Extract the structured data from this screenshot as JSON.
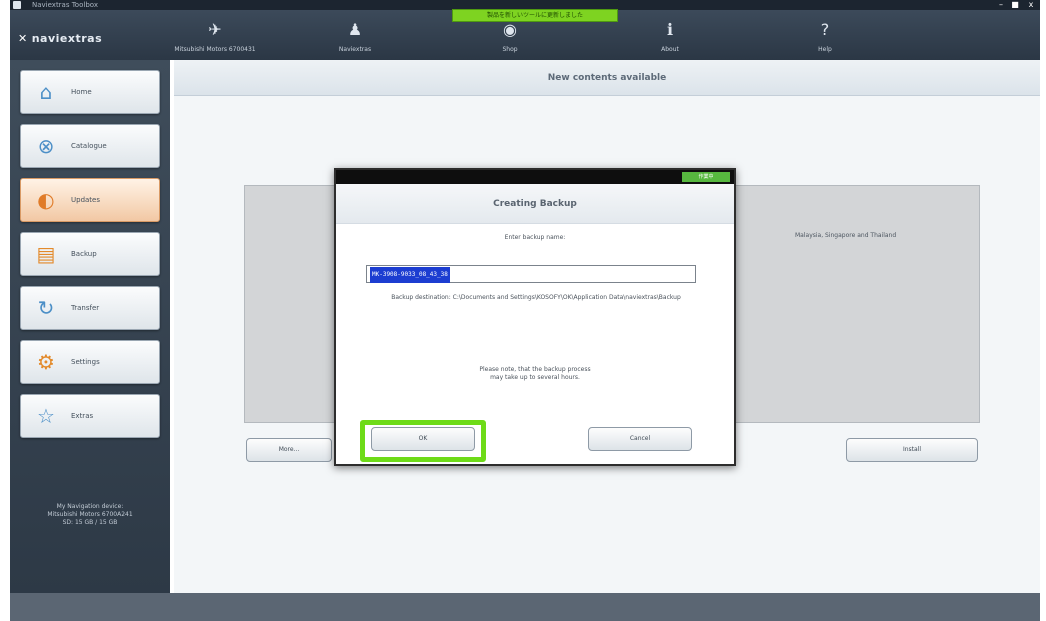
{
  "window": {
    "title": "Naviextras Toolbox",
    "controls": [
      "–",
      "■",
      "x"
    ]
  },
  "notice": "製品を新しいツールに更新しました",
  "topnav": {
    "logo": "naviextras",
    "tabs": [
      {
        "icon": "satellite-icon",
        "glyph": "✈",
        "label": "Mitsubishi Motors 6700431"
      },
      {
        "icon": "market-icon",
        "glyph": "♟",
        "label": "Naviextras"
      },
      {
        "icon": "globe-icon",
        "glyph": "◉",
        "label": "Shop"
      },
      {
        "icon": "info-icon",
        "glyph": "ℹ",
        "label": "About"
      },
      {
        "icon": "help-icon",
        "glyph": "?",
        "label": "Help"
      }
    ]
  },
  "sidebar": {
    "items": [
      {
        "label": "Home",
        "icon": "home-icon",
        "glyph": "⌂"
      },
      {
        "label": "Catalogue",
        "icon": "catalogue-icon",
        "glyph": "⊗"
      },
      {
        "label": "Updates",
        "icon": "updates-icon",
        "glyph": "◐"
      },
      {
        "label": "Backup",
        "icon": "backup-icon",
        "glyph": "▤"
      },
      {
        "label": "Transfer",
        "icon": "transfer-icon",
        "glyph": "↻"
      },
      {
        "label": "Settings",
        "icon": "settings-icon",
        "glyph": "⚙"
      },
      {
        "label": "Extras",
        "icon": "extras-icon",
        "glyph": "☆"
      }
    ],
    "active_index": 2,
    "device_info": [
      "My Navigation device:",
      "Mitsubishi Motors 6700A241",
      "SD: 15 GB / 15 GB"
    ]
  },
  "main": {
    "header": "New contents available",
    "panel_text": "Malaysia, Singapore and Thailand",
    "left_button": "More...",
    "right_button": "Install"
  },
  "dialog": {
    "tag": "作業中",
    "title": "Creating Backup",
    "prompt": "Enter backup name:",
    "input_value": "MK-3908-9033_08_43_38",
    "destination": "Backup destination: C:\\Documents and Settings\\KOSOFY\\OK\\Application Data\\naviextras\\Backup",
    "note_line1": "Please note, that the backup process",
    "note_line2": "may take up to several hours.",
    "ok_label": "OK",
    "cancel_label": "Cancel",
    "highlight_color": "#6edb18"
  }
}
